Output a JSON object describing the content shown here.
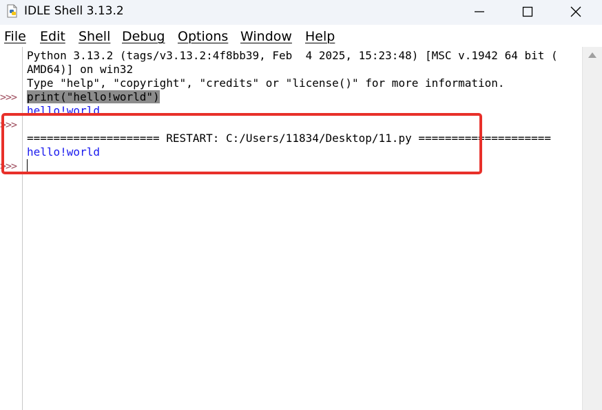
{
  "window": {
    "title": "IDLE Shell 3.13.2",
    "icon": "python-file-icon",
    "controls": [
      "minimize-icon",
      "maximize-icon",
      "close-icon"
    ]
  },
  "menu": {
    "file": "File",
    "edit": "Edit",
    "shell": "Shell",
    "debug": "Debug",
    "options": "Options",
    "window": "Window",
    "help": "Help"
  },
  "shell": {
    "banner_line1": "Python 3.13.2 (tags/v3.13.2:4f8bb39, Feb  4 2025, 15:23:48) [MSC v.1942 64 bit (",
    "banner_line2": "AMD64)] on win32",
    "banner_line3": "Type \"help\", \"copyright\", \"credits\" or \"license()\" for more information.",
    "prompt": ">>>",
    "command": "print(\"hello!world\")",
    "output1": "hello!world",
    "restart_line": "==================== RESTART: C:/Users/11834/Desktop/11.py ====================",
    "output2": "hello!world"
  },
  "colors": {
    "prompt": "#a05060",
    "stdout": "#1a1aee",
    "highlight": "#8c8c8c",
    "annotation": "#e8302a"
  }
}
